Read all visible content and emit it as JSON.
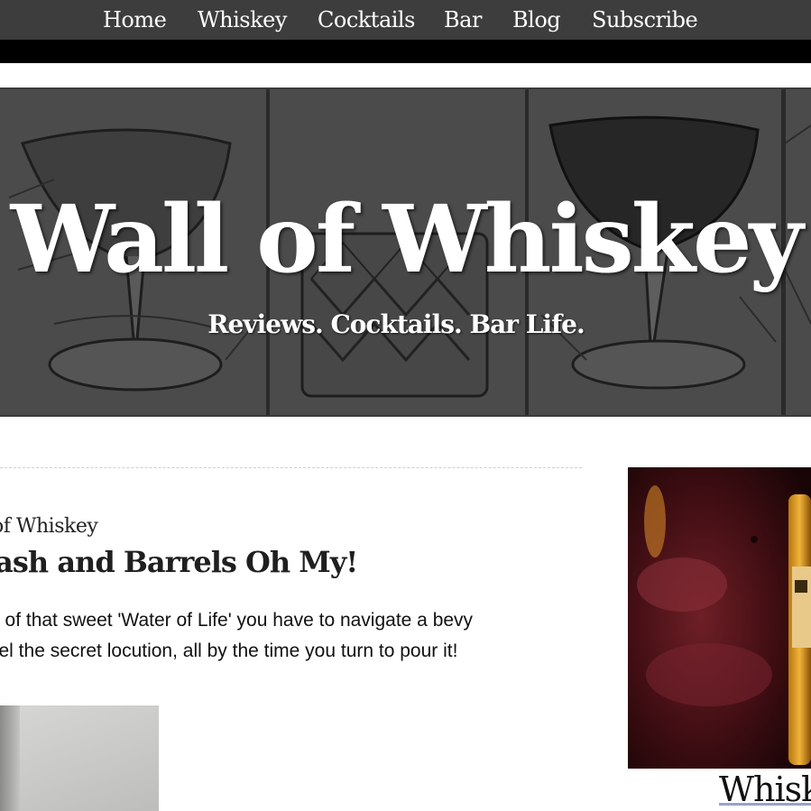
{
  "nav": {
    "items": [
      "Home",
      "Whiskey",
      "Cocktails",
      "Bar",
      "Blog",
      "Subscribe"
    ]
  },
  "banner": {
    "title": "Wall of Whiskey",
    "tagline": "Reviews. Cocktails. Bar Life."
  },
  "post": {
    "category": "of Whiskey",
    "title": "lash and Barrels Oh My!",
    "excerpt_line1": "e of that sweet 'Water of Life' you have to navigate a bevy",
    "excerpt_line2": "vel the secret locution, all by the time you turn to pour it!"
  },
  "sidebar": {
    "link_text": "Whisk"
  },
  "colors": {
    "nav_bg": "#3d3d3d",
    "banner_bg": "#4c4c4c",
    "accent_link_underline": "#9aa0d0"
  }
}
